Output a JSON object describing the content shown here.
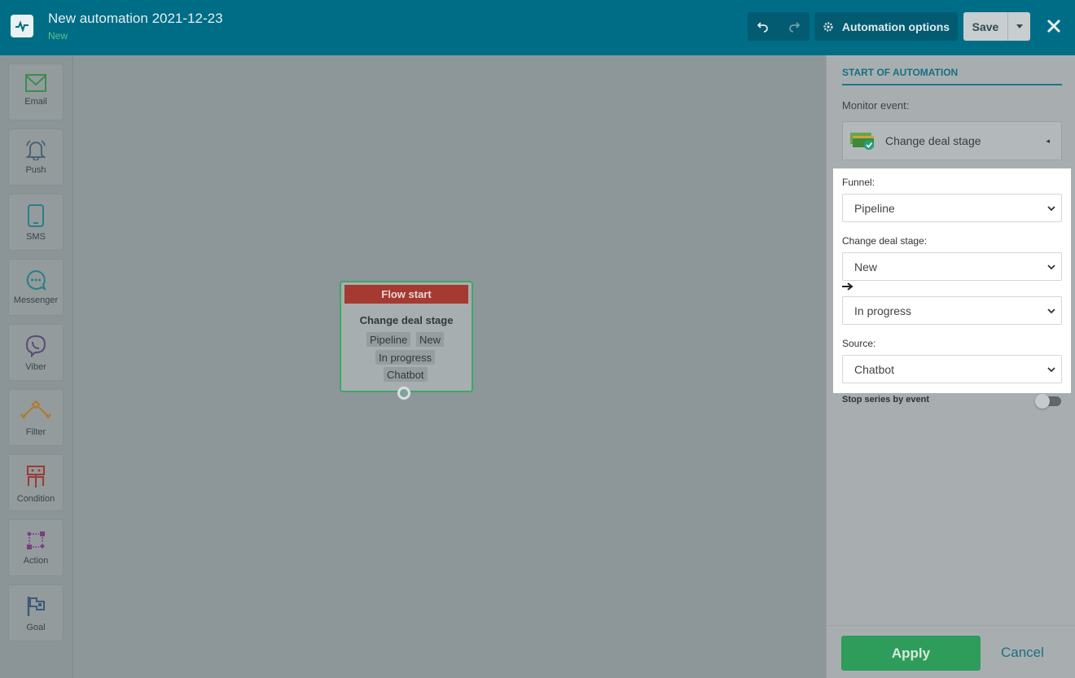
{
  "header": {
    "title": "New automation 2021-12-23",
    "status": "New",
    "options_label": "Automation options",
    "save_label": "Save"
  },
  "sidebar": {
    "items": [
      {
        "label": "Email",
        "icon": "envelope-icon",
        "color": "#3d8b4f"
      },
      {
        "label": "Push",
        "icon": "bell-icon",
        "color": "#4d6270"
      },
      {
        "label": "SMS",
        "icon": "smartphone-icon",
        "color": "#2a7f86"
      },
      {
        "label": "Messenger",
        "icon": "chat-bubble-icon",
        "color": "#2a7f86"
      },
      {
        "label": "Viber",
        "icon": "viber-icon",
        "color": "#5a4a78"
      },
      {
        "label": "Filter",
        "icon": "filter-icon",
        "color": "#b07a28"
      },
      {
        "label": "Condition",
        "icon": "condition-icon",
        "color": "#9a3a36"
      },
      {
        "label": "Action",
        "icon": "action-icon",
        "color": "#7a3d82"
      },
      {
        "label": "Goal",
        "icon": "flag-icon",
        "color": "#3d5a7a"
      }
    ]
  },
  "node": {
    "header": "Flow start",
    "title": "Change deal stage",
    "tags": [
      "Pipeline",
      "New",
      "In progress",
      "Chatbot"
    ]
  },
  "panel": {
    "heading": "START OF AUTOMATION",
    "monitor_label": "Monitor event:",
    "event_value": "Change deal stage",
    "funnel_label": "Funnel:",
    "funnel_value": "Pipeline",
    "stage_label": "Change deal stage:",
    "stage_from": "New",
    "stage_to": "In progress",
    "source_label": "Source:",
    "source_value": "Chatbot",
    "stop_label": "Stop series by event",
    "apply_label": "Apply",
    "cancel_label": "Cancel"
  },
  "colors": {
    "header_bg": "#006d86",
    "accent_green": "#2e9c5b",
    "flow_start_red": "#a43a32"
  }
}
